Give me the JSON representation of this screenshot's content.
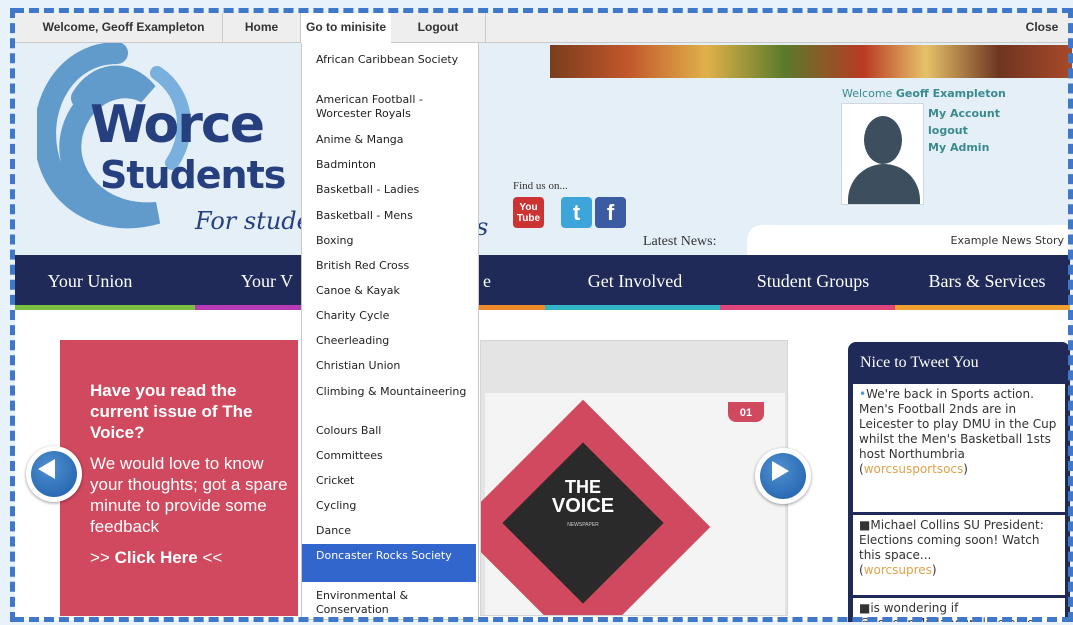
{
  "admin_bar": {
    "welcome": "Welcome, Geoff Exampleton",
    "home": "Home",
    "minisite": "Go to minisite",
    "logout": "Logout",
    "close": "Close"
  },
  "header": {
    "logo_line1": "Worce",
    "logo_line2": "Students",
    "logo_tagline": "For stude",
    "logo_tagline_end": "s",
    "find_us": "Find us on...",
    "social": [
      "youtube-icon",
      "twitter-icon",
      "facebook-icon"
    ],
    "youtube_label": "You Tube",
    "twitter_label": "t",
    "facebook_label": "f",
    "user_welcome": "Welcome",
    "user_name": "Geoff Exampleton",
    "user_links": [
      "My Account",
      "logout",
      "My Admin"
    ],
    "latest_news_label": "Latest News:",
    "latest_news_story": "Example News Story"
  },
  "nav": {
    "items": [
      "Your Union",
      "Your V",
      "e",
      "Get Involved",
      "Student Groups",
      "Bars & Services"
    ],
    "colors": [
      "#7bc043",
      "#b83ab5",
      "#ef8a2b",
      "#2fb5c6",
      "#e0447a",
      "#f0a030"
    ]
  },
  "slideshow": {
    "heading": "Have you read the current issue of The Voice?",
    "body": "We would love to know your thoughts; got a spare minute to provide some feedback",
    "cta_prefix": ">> ",
    "cta_label": "Click Here",
    "cta_suffix": " <<",
    "magazine_tag": "01",
    "magazine_title_1": "THE",
    "magazine_title_2": "VOICE",
    "magazine_subtitle": "NEWSPAPER"
  },
  "twitter": {
    "heading": "Nice to Tweet You",
    "tweets": [
      {
        "text": "We're back in Sports action. Men's Football 2nds are in Leicester to play DMU in the Cup whilst the Men's Basketball 1sts host Northumbria",
        "handle": "worcsusportsocs"
      },
      {
        "text": "Michael Collins SU President: Elections coming soon! Watch this space...",
        "handle": "worcsupres"
      },
      {
        "text": "is wondering if @LondonMidland will be able",
        "handle": ""
      }
    ]
  },
  "minisite_menu": {
    "items": [
      "African Caribbean Society",
      "American Football - Worcester Royals",
      "Anime & Manga",
      "Badminton",
      "Basketball - Ladies",
      "Basketball - Mens",
      "Boxing",
      "British Red Cross",
      "Canoe & Kayak",
      "Charity Cycle",
      "Cheerleading",
      "Christian Union",
      "Climbing & Mountaineering",
      "Colours Ball",
      "Committees",
      "Cricket",
      "Cycling",
      "Dance",
      "Doncaster Rocks Society",
      "Environmental & Conservation"
    ],
    "selected": "Doncaster Rocks Society"
  },
  "colors": {
    "navy": "#1f2a59",
    "accent_blue": "#3366cc",
    "slide_red": "#d0495e",
    "teal": "#3b8a8f",
    "handle_orange": "#e0a24a"
  }
}
